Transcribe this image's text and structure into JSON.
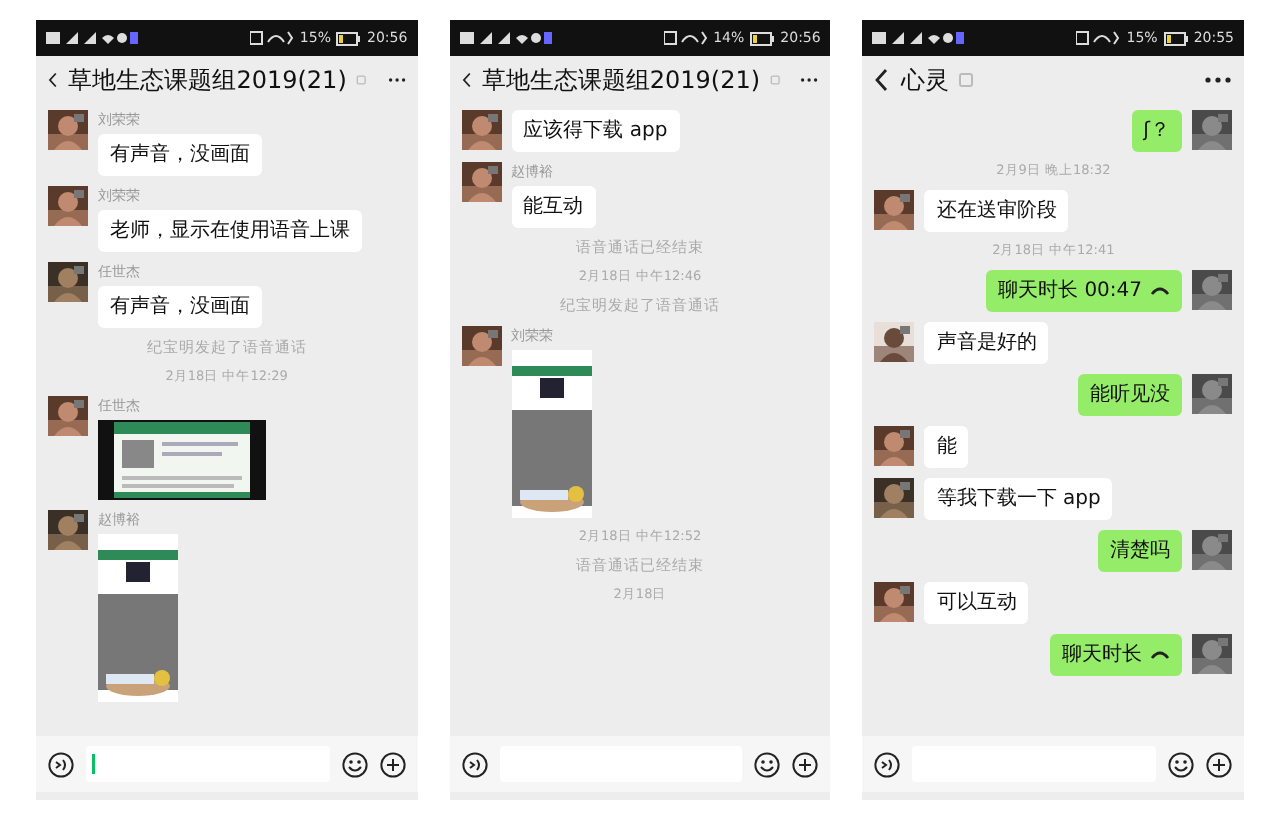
{
  "phones": [
    {
      "status_bar": {
        "battery": "15%",
        "time": "20:56"
      },
      "title": "草地生态课题组2019(21)",
      "messages": [
        {
          "kind": "text",
          "outgoing": false,
          "sender": "刘荣荣",
          "text": "有声音，没画面"
        },
        {
          "kind": "text",
          "outgoing": false,
          "sender": "刘荣荣",
          "text": "老师，显示在使用语音上课"
        },
        {
          "kind": "text",
          "outgoing": false,
          "sender": "任世杰",
          "text": "有声音，没画面"
        },
        {
          "kind": "system",
          "text": "纪宝明发起了语音通话"
        },
        {
          "kind": "time",
          "text": "2月18日 中午12:29"
        },
        {
          "outgoing": false,
          "sender": "任世杰",
          "wide": true
        },
        {
          "outgoing": false,
          "sender": "赵博裕",
          "wide": false
        }
      ]
    },
    {
      "status_bar": {
        "battery": "14%",
        "time": "20:56"
      },
      "title": "草地生态课题组2019(21)",
      "messages": [
        {
          "kind": "text",
          "outgoing": false,
          "text": "应该得下载 app"
        },
        {
          "kind": "text",
          "outgoing": false,
          "sender": "赵博裕",
          "text": "能互动"
        },
        {
          "kind": "system",
          "text": "语音通话已经结束"
        },
        {
          "kind": "time",
          "text": "2月18日 中午12:46"
        },
        {
          "kind": "system",
          "text": "纪宝明发起了语音通话"
        },
        {
          "outgoing": false,
          "sender": "刘荣荣",
          "wide": false
        },
        {
          "kind": "time",
          "text": "2月18日 中午12:52"
        },
        {
          "kind": "system",
          "text": "语音通话已经结束"
        },
        {
          "kind": "time",
          "text": "2月18日"
        }
      ]
    },
    {
      "status_bar": {
        "battery": "15%",
        "time": "20:55"
      },
      "title": "心灵",
      "messages": [
        {
          "kind": "text",
          "outgoing": true,
          "text": "ʃ？"
        },
        {
          "kind": "time",
          "text": "2月9日 晚上18:32"
        },
        {
          "kind": "text",
          "outgoing": false,
          "text": "还在送审阶段"
        },
        {
          "kind": "time",
          "text": "2月18日 中午12:41"
        },
        {
          "kind": "call",
          "outgoing": true,
          "text": "聊天时长 00:47"
        },
        {
          "kind": "text",
          "outgoing": false,
          "text": "声音是好的"
        },
        {
          "kind": "text",
          "outgoing": true,
          "text": "能听见没"
        },
        {
          "kind": "text",
          "outgoing": false,
          "text": "能"
        },
        {
          "kind": "text",
          "outgoing": false,
          "text": "等我下载一下 app"
        },
        {
          "kind": "text",
          "outgoing": true,
          "text": "清楚吗"
        },
        {
          "kind": "text",
          "outgoing": false,
          "text": "可以互动"
        },
        {
          "kind": "call",
          "outgoing": true,
          "text": "聊天时长"
        }
      ]
    }
  ]
}
